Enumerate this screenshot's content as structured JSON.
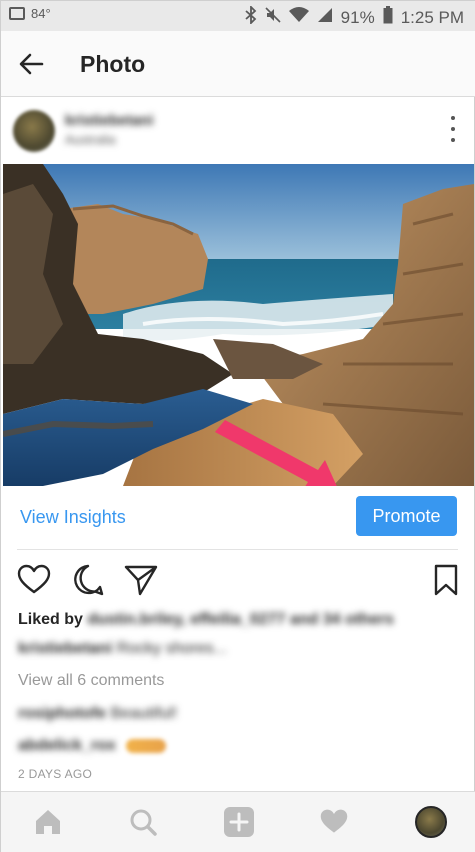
{
  "status_bar": {
    "temperature": "84°",
    "battery": "91%",
    "time": "1:25 PM"
  },
  "header": {
    "title": "Photo"
  },
  "post": {
    "user_name": "kristiebetani",
    "user_location": "Australia",
    "actions": {
      "view_insights": "View Insights",
      "promote": "Promote"
    },
    "likes": {
      "prefix": "Liked by",
      "names": "dustin.briley, effeilia_0277 and 34 others"
    },
    "caption": {
      "username": "kristiebetani",
      "text": "Rocky shores..."
    },
    "view_comments": "View all 6 comments",
    "comments": [
      {
        "username": "rosiphotofe",
        "text": "Beautiful!"
      },
      {
        "username": "abdelick_rox",
        "text": ""
      }
    ],
    "timestamp": "2 DAYS AGO"
  },
  "colors": {
    "accent": "#3897f0",
    "arrow": "#f0386b"
  }
}
